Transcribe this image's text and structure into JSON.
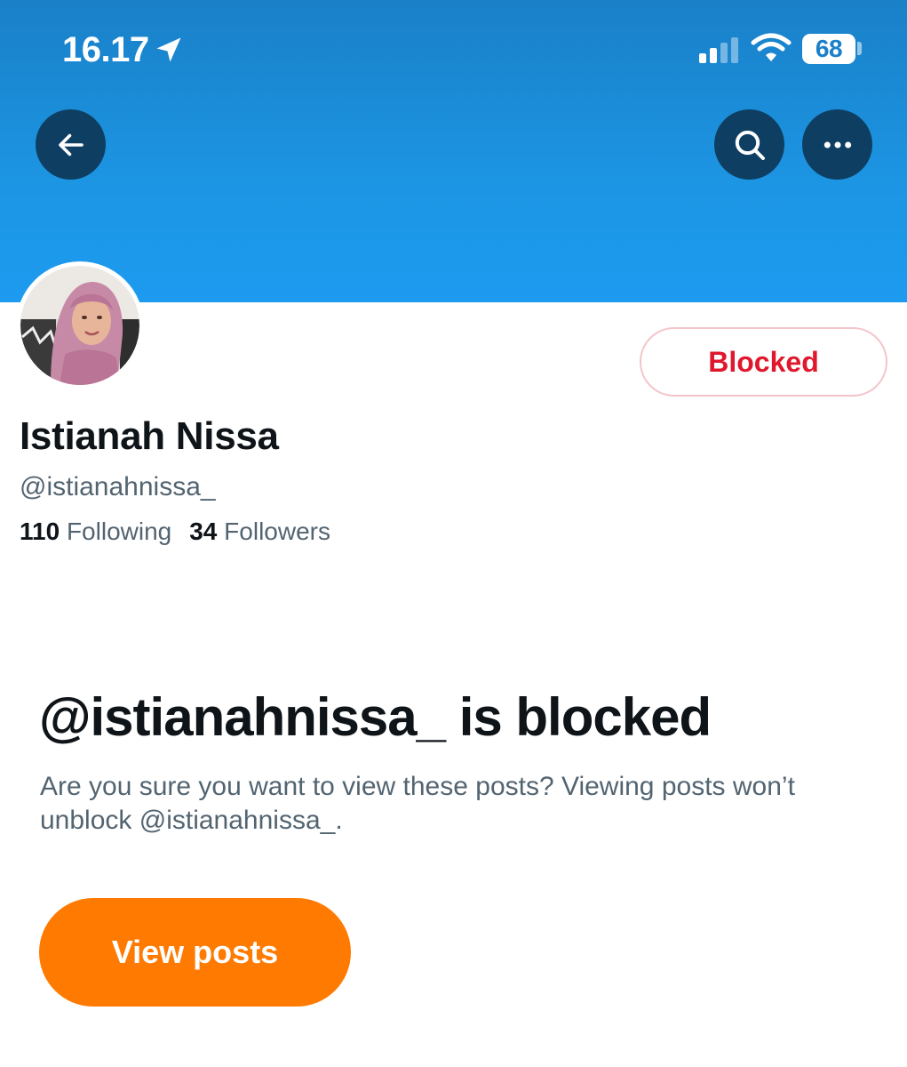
{
  "status_bar": {
    "time": "16.17",
    "battery_level": "68",
    "icons": [
      "location-arrow-icon",
      "cellular-signal-icon",
      "wifi-icon",
      "battery-icon"
    ]
  },
  "header": {
    "back_icon": "arrow-left-icon",
    "search_icon": "search-icon",
    "more_icon": "more-horizontal-icon",
    "banner_color": "#1d9bf0"
  },
  "profile": {
    "display_name": "Istianah Nissa",
    "handle": "@istianahnissa_",
    "following_count": "110",
    "following_label": "Following",
    "followers_count": "34",
    "followers_label": "Followers",
    "blocked_button_label": "Blocked",
    "blocked_color": "#e0182d"
  },
  "blocked_notice": {
    "title": "@istianahnissa_ is blocked",
    "description": "Are you sure you want to view these posts? Viewing posts won’t unblock @istianahnissa_.",
    "view_posts_label": "View posts",
    "button_color": "#ff7a00"
  }
}
